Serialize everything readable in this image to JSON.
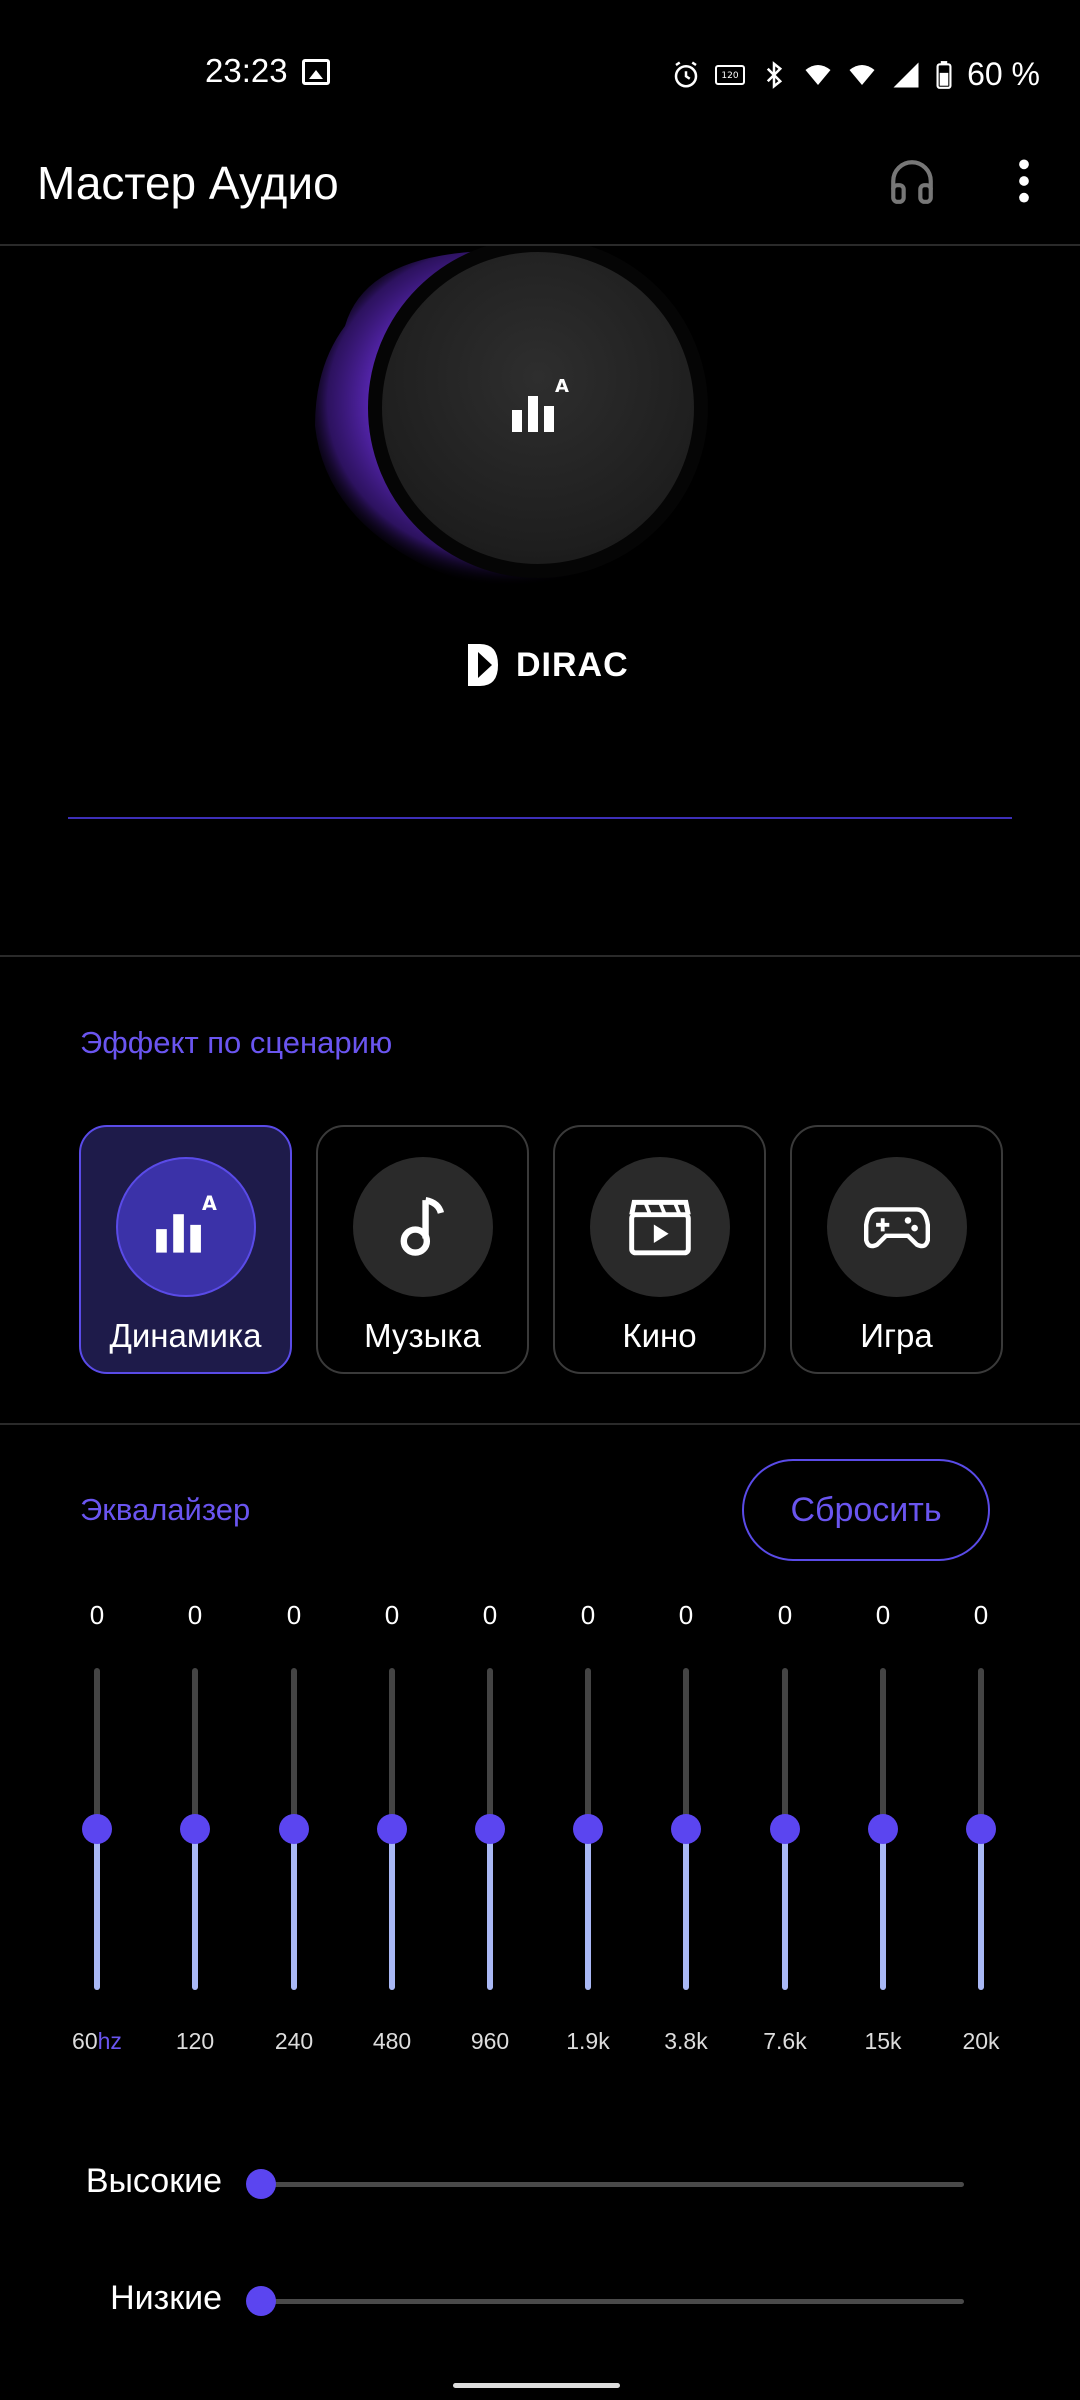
{
  "status_bar": {
    "time": "23:23",
    "battery": "60 %",
    "icons": [
      "gallery-icon",
      "alarm-icon",
      "120hz-icon",
      "bluetooth-icon",
      "wifi6-icon",
      "wifi6-icon",
      "signal-icon",
      "battery-icon"
    ]
  },
  "app_bar": {
    "title": "Мастер Аудио",
    "icons": [
      "headphones-icon",
      "more-vert-icon"
    ]
  },
  "dial": {
    "brand": "DIRAC",
    "icon": "dynamic-audio-icon",
    "glow_color": "#6b2fd8"
  },
  "scenario": {
    "label": "Эффект по сценарию",
    "cards": [
      {
        "label": "Динамика",
        "icon": "dynamic-audio-icon",
        "active": true
      },
      {
        "label": "Музыка",
        "icon": "music-note-icon",
        "active": false
      },
      {
        "label": "Кино",
        "icon": "movie-icon",
        "active": false
      },
      {
        "label": "Игра",
        "icon": "gamepad-icon",
        "active": false
      }
    ]
  },
  "equalizer": {
    "label": "Эквалайзер",
    "reset_label": "Сбросить",
    "bands": [
      {
        "freq": "60",
        "unit": "hz",
        "value": "0"
      },
      {
        "freq": "120",
        "value": "0"
      },
      {
        "freq": "240",
        "value": "0"
      },
      {
        "freq": "480",
        "value": "0"
      },
      {
        "freq": "960",
        "value": "0"
      },
      {
        "freq": "1.9k",
        "value": "0"
      },
      {
        "freq": "3.8k",
        "value": "0"
      },
      {
        "freq": "7.6k",
        "value": "0"
      },
      {
        "freq": "15k",
        "value": "0"
      },
      {
        "freq": "20k",
        "value": "0"
      }
    ]
  },
  "tone": {
    "treble_label": "Высокие",
    "bass_label": "Низкие",
    "treble_level": 0,
    "bass_level": 0
  },
  "colors": {
    "accent": "#5b45f0",
    "accent_text": "#6a55f0",
    "eq_fill": "#a9b8f5"
  }
}
